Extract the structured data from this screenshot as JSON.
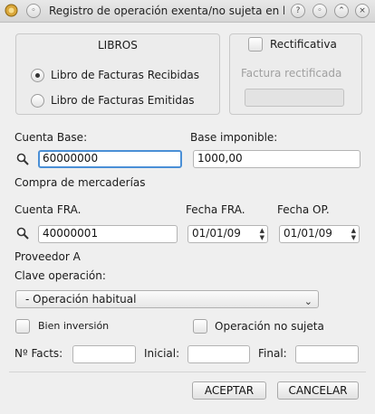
{
  "window": {
    "title": "Registro de operación exenta/no sujeta en l...",
    "buttons": [
      "?",
      "◦",
      "⌃",
      "⌄",
      "×"
    ]
  },
  "libros": {
    "title": "LIBROS",
    "options": [
      {
        "label": "Libro de Facturas Recibidas",
        "checked": true
      },
      {
        "label": "Libro de Facturas Emitidas",
        "checked": false
      }
    ]
  },
  "rectificativa": {
    "checkbox_label": "Rectificativa",
    "factura_label": "Factura rectificada",
    "factura_value": ""
  },
  "cuenta_base": {
    "label": "Cuenta Base:",
    "value": "60000000",
    "description": "Compra de mercaderías"
  },
  "base_imponible": {
    "label": "Base imponible:",
    "value": "1000,00"
  },
  "cuenta_fra": {
    "label": "Cuenta FRA.",
    "value": "40000001",
    "description": "Proveedor A"
  },
  "fecha_fra": {
    "label": "Fecha FRA.",
    "value": "01/01/09"
  },
  "fecha_op": {
    "label": "Fecha OP.",
    "value": "01/01/09"
  },
  "clave_operacion": {
    "label": "Clave operación:",
    "selected": "- Operación habitual"
  },
  "bien_inversion": {
    "label": "Bien inversión",
    "checked": false
  },
  "operacion_no_sujeta": {
    "label": "Operación no sujeta",
    "checked": false
  },
  "facts": {
    "n_label": "Nº Facts:",
    "n_value": "",
    "inicial_label": "Inicial:",
    "inicial_value": "",
    "final_label": "Final:",
    "final_value": ""
  },
  "actions": {
    "aceptar": "ACEPTAR",
    "cancelar": "CANCELAR"
  },
  "colors": {
    "focus_border": "#4a8fd6",
    "window_bg": "#efefef"
  }
}
